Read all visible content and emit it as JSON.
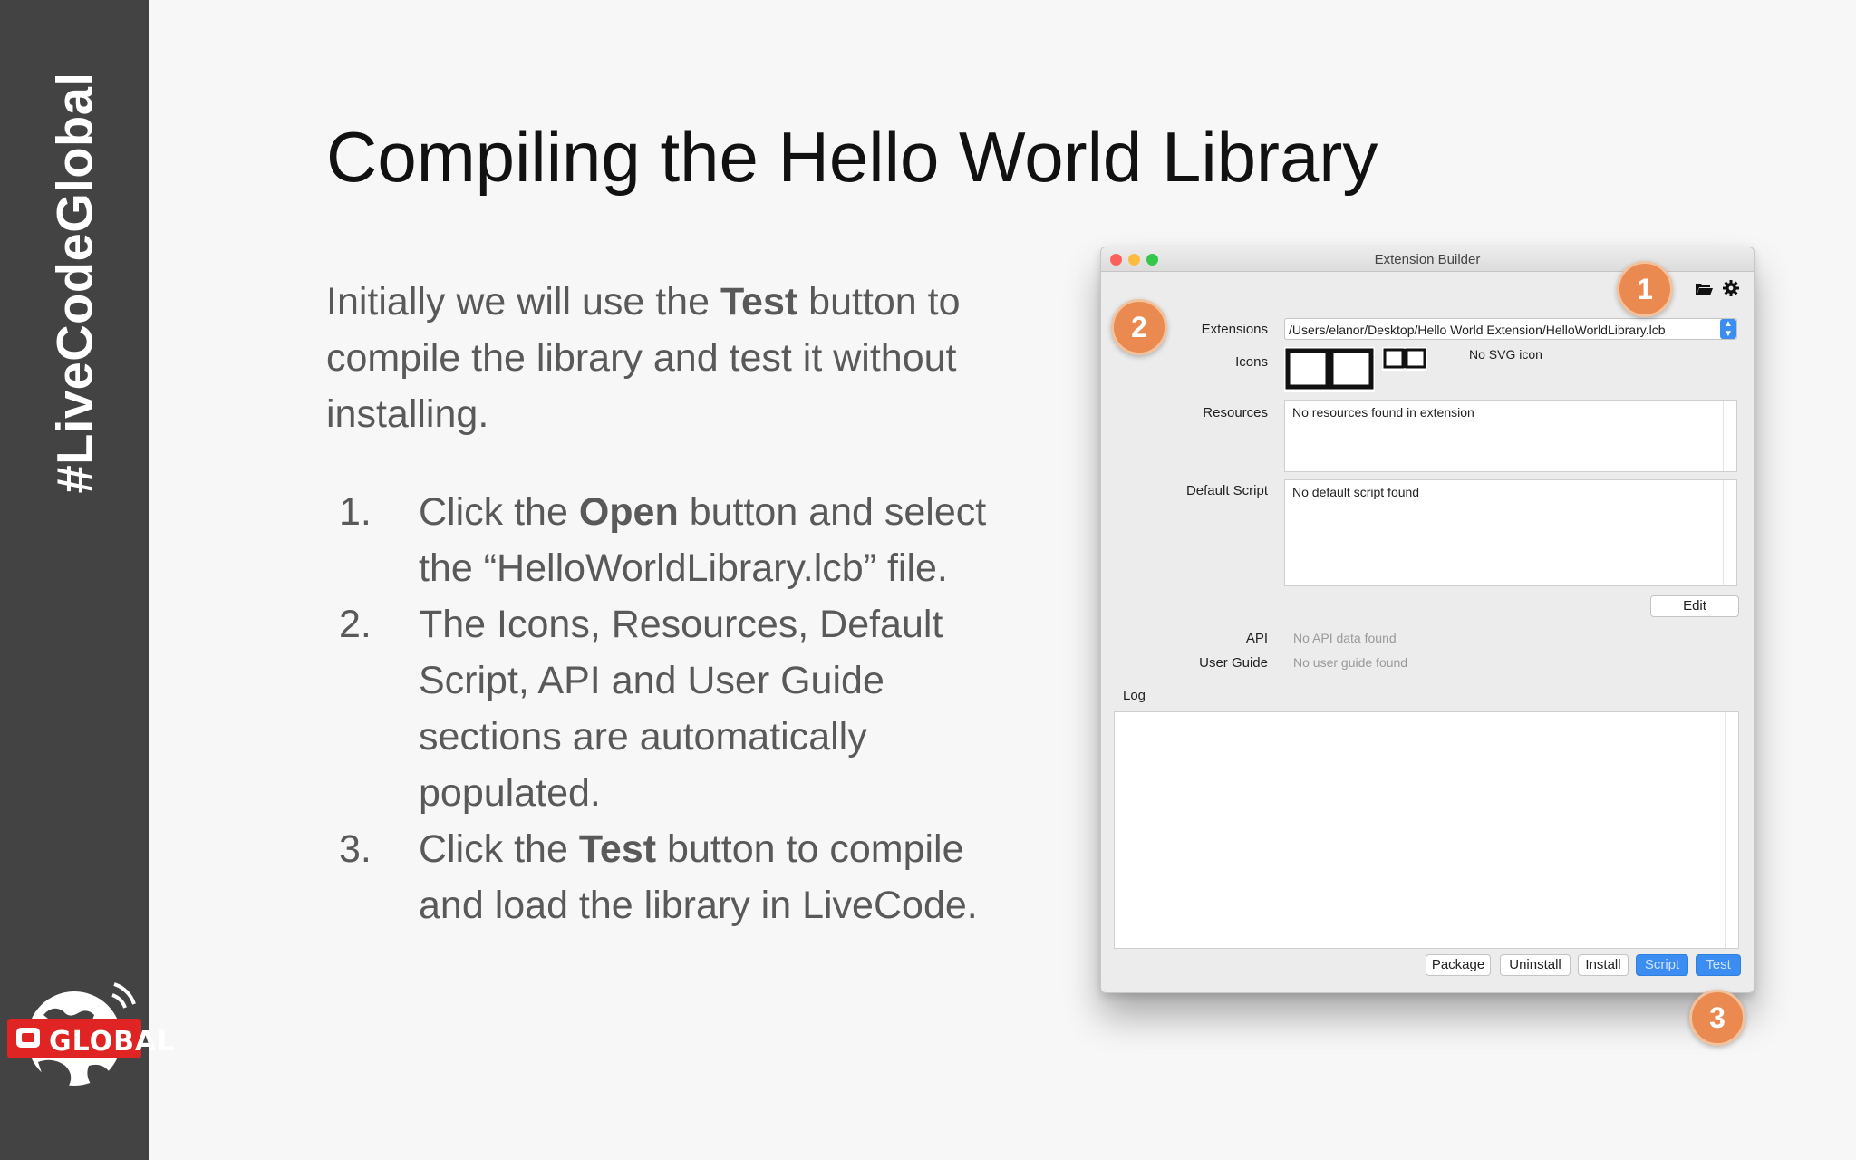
{
  "sidebar": {
    "hashtag": "#LiveCodeGlobal",
    "logo_text": "GLOBAL"
  },
  "slide": {
    "title": "Compiling the Hello World Library",
    "intro": {
      "before": "Initially we will use the ",
      "bold": "Test",
      "after": " button to compile the library and test it without installing."
    },
    "steps": [
      {
        "number": "1.",
        "before": "Click the ",
        "bold": "Open",
        "after": " button and select the “HelloWorldLibrary.lcb” file."
      },
      {
        "number": "2.",
        "before": "The Icons, Resources, Default Script, API and User Guide sections are automatically populated.",
        "bold": "",
        "after": ""
      },
      {
        "number": "3.",
        "before": "Click the ",
        "bold": "Test",
        "after": " button to compile and load the library in LiveCode."
      }
    ]
  },
  "window": {
    "title": "Extension Builder",
    "extensions_label": "Extensions",
    "extensions_path": "/Users/elanor/Desktop/Hello World Extension/HelloWorldLibrary.lcb",
    "icons_label": "Icons",
    "svg_icon_text": "No SVG icon",
    "resources_label": "Resources",
    "resources_text": "No resources found in extension",
    "default_script_label": "Default Script",
    "default_script_text": "No default script found",
    "edit_button": "Edit",
    "api_label": "API",
    "api_text": "No API data found",
    "user_guide_label": "User Guide",
    "user_guide_text": "No user guide found",
    "log_label": "Log",
    "buttons": [
      "Package",
      "Uninstall",
      "Install",
      "Script",
      "Test"
    ],
    "icons": [
      "folder-open-icon",
      "gear-icon"
    ],
    "colors": {
      "accent_blue": "#3b8df2",
      "badge_orange": "#ea8a50"
    }
  },
  "badges": [
    "1",
    "2",
    "3"
  ]
}
